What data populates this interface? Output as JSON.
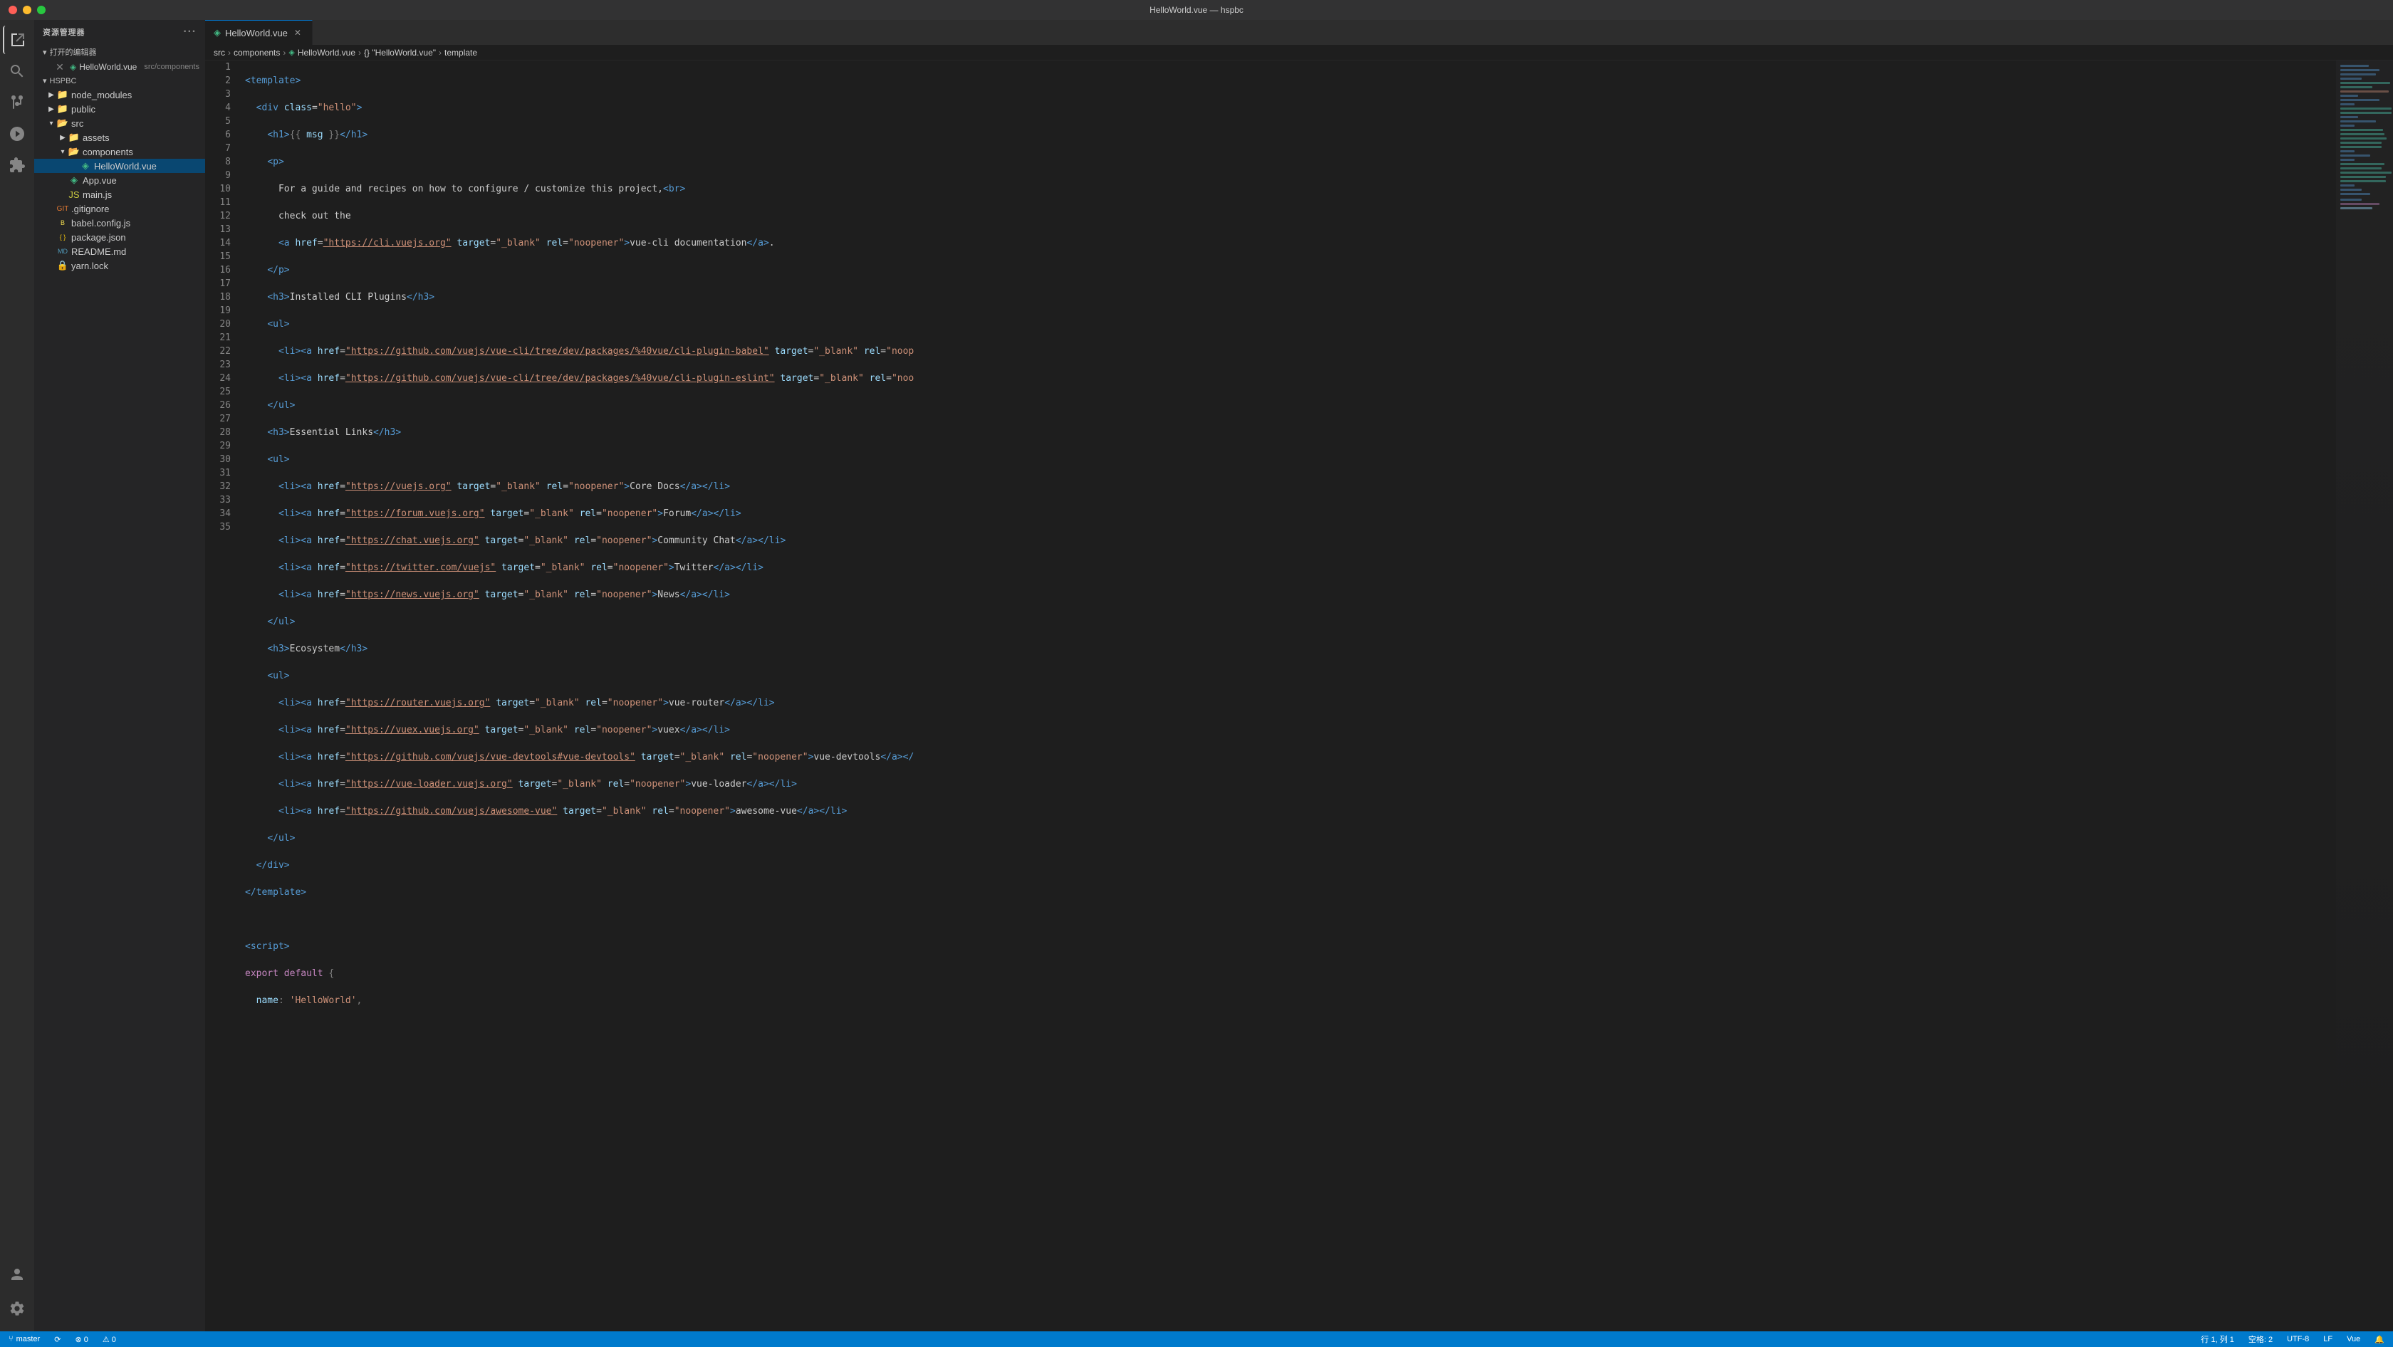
{
  "titleBar": {
    "title": "HelloWorld.vue — hspbc"
  },
  "activityBar": {
    "icons": [
      {
        "name": "explorer-icon",
        "symbol": "⎇",
        "tooltip": "Explorer",
        "active": true
      },
      {
        "name": "search-icon",
        "symbol": "🔍",
        "tooltip": "Search",
        "active": false
      },
      {
        "name": "source-control-icon",
        "symbol": "⑂",
        "tooltip": "Source Control",
        "active": false
      },
      {
        "name": "debug-icon",
        "symbol": "▷",
        "tooltip": "Run and Debug",
        "active": false
      },
      {
        "name": "extensions-icon",
        "symbol": "⊞",
        "tooltip": "Extensions",
        "active": false
      }
    ],
    "bottomIcons": [
      {
        "name": "account-icon",
        "symbol": "👤",
        "tooltip": "Account"
      },
      {
        "name": "settings-icon",
        "symbol": "⚙",
        "tooltip": "Settings"
      }
    ]
  },
  "sidebar": {
    "title": "资源管理器",
    "openEditors": {
      "label": "打开的编辑器",
      "items": [
        {
          "name": "HelloWorld.vue",
          "path": "src/components",
          "icon": "vue",
          "modified": true
        }
      ]
    },
    "rootLabel": "HSPBC",
    "fileTree": [
      {
        "id": "node_modules",
        "label": "node_modules",
        "type": "folder",
        "depth": 1,
        "collapsed": true
      },
      {
        "id": "public",
        "label": "public",
        "type": "folder",
        "depth": 1,
        "collapsed": true
      },
      {
        "id": "src",
        "label": "src",
        "type": "folder",
        "depth": 1,
        "collapsed": false
      },
      {
        "id": "assets",
        "label": "assets",
        "type": "folder",
        "depth": 2,
        "collapsed": true
      },
      {
        "id": "components",
        "label": "components",
        "type": "folder",
        "depth": 2,
        "collapsed": false
      },
      {
        "id": "HelloWorld.vue",
        "label": "HelloWorld.vue",
        "type": "vue",
        "depth": 3,
        "active": true
      },
      {
        "id": "App.vue",
        "label": "App.vue",
        "type": "vue",
        "depth": 2
      },
      {
        "id": "main.js",
        "label": "main.js",
        "type": "js",
        "depth": 2
      },
      {
        "id": ".gitignore",
        "label": ".gitignore",
        "type": "gitignore",
        "depth": 1
      },
      {
        "id": "babel.config.js",
        "label": "babel.config.js",
        "type": "babel",
        "depth": 1
      },
      {
        "id": "package.json",
        "label": "package.json",
        "type": "json",
        "depth": 1
      },
      {
        "id": "README.md",
        "label": "README.md",
        "type": "md",
        "depth": 1
      },
      {
        "id": "yarn.lock",
        "label": "yarn.lock",
        "type": "lock",
        "depth": 1
      }
    ]
  },
  "tabs": [
    {
      "label": "HelloWorld.vue",
      "icon": "vue",
      "active": true,
      "modified": false
    }
  ],
  "breadcrumb": {
    "items": [
      "src",
      "components",
      "HelloWorld.vue",
      "{} \"HelloWorld.vue\"",
      "template"
    ]
  },
  "editor": {
    "lines": [
      {
        "num": 1,
        "content": "<template>"
      },
      {
        "num": 2,
        "content": "  <div class=\"hello\">"
      },
      {
        "num": 3,
        "content": "    <h1>{{ msg }}</h1>"
      },
      {
        "num": 4,
        "content": "    <p>"
      },
      {
        "num": 5,
        "content": "      For a guide and recipes on how to configure / customize this project,<br>"
      },
      {
        "num": 6,
        "content": "      check out the"
      },
      {
        "num": 7,
        "content": "      <a href=\"https://cli.vuejs.org\" target=\"_blank\" rel=\"noopener\">vue-cli documentation</a>."
      },
      {
        "num": 8,
        "content": "    </p>"
      },
      {
        "num": 9,
        "content": "    <h3>Installed CLI Plugins</h3>"
      },
      {
        "num": 10,
        "content": "    <ul>"
      },
      {
        "num": 11,
        "content": "      <li><a href=\"https://github.com/vuejs/vue-cli/tree/dev/packages/%40vue/cli-plugin-babel\" target=\"_blank\" rel=\"noop"
      },
      {
        "num": 12,
        "content": "      <li><a href=\"https://github.com/vuejs/vue-cli/tree/dev/packages/%40vue/cli-plugin-eslint\" target=\"_blank\" rel=\"noo"
      },
      {
        "num": 13,
        "content": "    </ul>"
      },
      {
        "num": 14,
        "content": "    <h3>Essential Links</h3>"
      },
      {
        "num": 15,
        "content": "    <ul>"
      },
      {
        "num": 16,
        "content": "      <li><a href=\"https://vuejs.org\" target=\"_blank\" rel=\"noopener\">Core Docs</a></li>"
      },
      {
        "num": 17,
        "content": "      <li><a href=\"https://forum.vuejs.org\" target=\"_blank\" rel=\"noopener\">Forum</a></li>"
      },
      {
        "num": 18,
        "content": "      <li><a href=\"https://chat.vuejs.org\" target=\"_blank\" rel=\"noopener\">Community Chat</a></li>"
      },
      {
        "num": 19,
        "content": "      <li><a href=\"https://twitter.com/vuejs\" target=\"_blank\" rel=\"noopener\">Twitter</a></li>"
      },
      {
        "num": 20,
        "content": "      <li><a href=\"https://news.vuejs.org\" target=\"_blank\" rel=\"noopener\">News</a></li>"
      },
      {
        "num": 21,
        "content": "    </ul>"
      },
      {
        "num": 22,
        "content": "    <h3>Ecosystem</h3>"
      },
      {
        "num": 23,
        "content": "    <ul>"
      },
      {
        "num": 24,
        "content": "      <li><a href=\"https://router.vuejs.org\" target=\"_blank\" rel=\"noopener\">vue-router</a></li>"
      },
      {
        "num": 25,
        "content": "      <li><a href=\"https://vuex.vuejs.org\" target=\"_blank\" rel=\"noopener\">vuex</a></li>"
      },
      {
        "num": 26,
        "content": "      <li><a href=\"https://github.com/vuejs/vue-devtools#vue-devtools\" target=\"_blank\" rel=\"noopener\">vue-devtools</a></"
      },
      {
        "num": 27,
        "content": "      <li><a href=\"https://vue-loader.vuejs.org\" target=\"_blank\" rel=\"noopener\">vue-loader</a></li>"
      },
      {
        "num": 28,
        "content": "      <li><a href=\"https://github.com/vuejs/awesome-vue\" target=\"_blank\" rel=\"noopener\">awesome-vue</a></li>"
      },
      {
        "num": 29,
        "content": "    </ul>"
      },
      {
        "num": 30,
        "content": "  </div>"
      },
      {
        "num": 31,
        "content": "</template>"
      },
      {
        "num": 32,
        "content": ""
      },
      {
        "num": 33,
        "content": "<script>"
      },
      {
        "num": 34,
        "content": "export default {"
      },
      {
        "num": 35,
        "content": "  name: 'HelloWorld',"
      }
    ]
  },
  "statusBar": {
    "left": {
      "branch": "master",
      "sync": "⑂",
      "errors": "⊗ 0",
      "warnings": "⚠ 0"
    },
    "right": {
      "position": "行 1, 列 1",
      "spaces": "空格: 2",
      "encoding": "UTF-8",
      "lineEnding": "LF",
      "language": "Vue",
      "feedback": "🔔"
    }
  }
}
